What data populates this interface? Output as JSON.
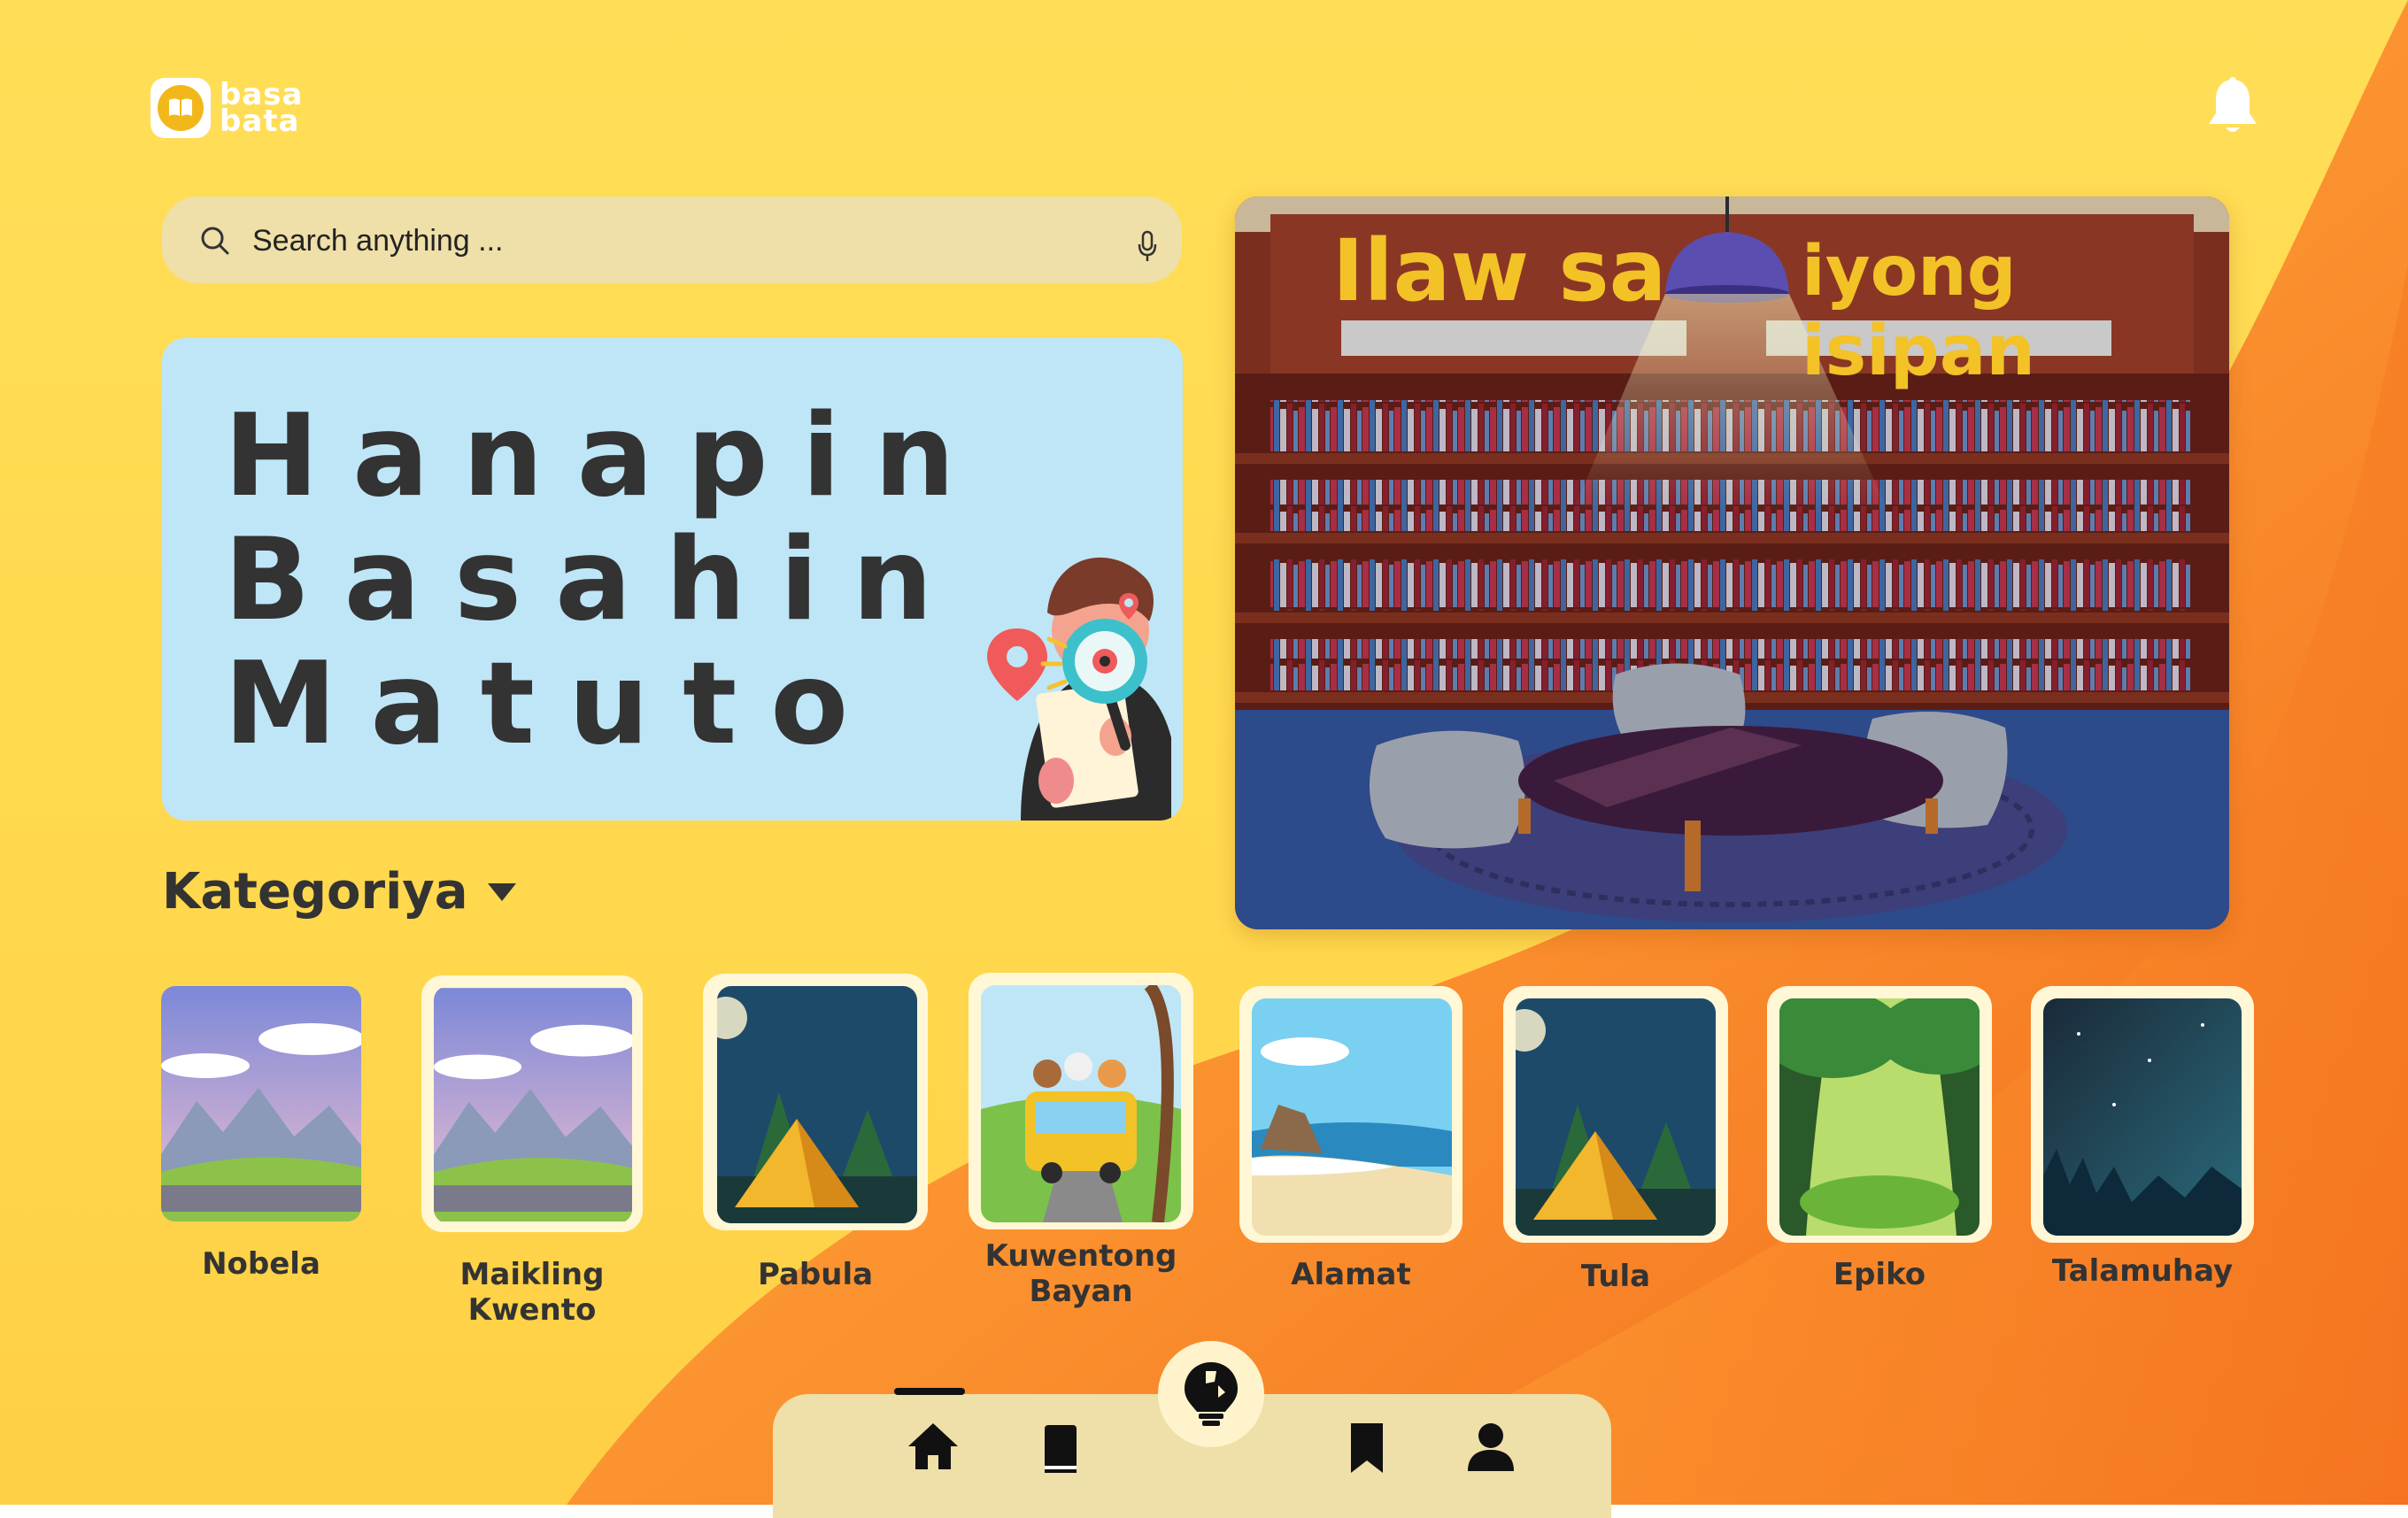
{
  "app": {
    "logo_text_top": "basa",
    "logo_text_bottom": "bata"
  },
  "search": {
    "placeholder": "Search anything ..."
  },
  "hero": {
    "line1": "Hanapin",
    "line2": "Basahin",
    "line3": "Matuto"
  },
  "banner": {
    "title_left": "Ilaw sa",
    "title_right": "iyong isipan"
  },
  "categories": {
    "title": "Kategoriya",
    "items": [
      {
        "label": "Nobela",
        "scene": "mountain"
      },
      {
        "label": "Maikling\nKwento",
        "scene": "mountain"
      },
      {
        "label": "Pabula",
        "scene": "camp"
      },
      {
        "label": "Kuwentong\nBayan",
        "scene": "bus"
      },
      {
        "label": "Alamat",
        "scene": "beach"
      },
      {
        "label": "Tula",
        "scene": "camp"
      },
      {
        "label": "Epiko",
        "scene": "forest"
      },
      {
        "label": "Talamuhay",
        "scene": "night"
      }
    ]
  },
  "nav": {
    "items": [
      "home-icon",
      "book-icon",
      "lightbulb-icon",
      "bookmark-icon",
      "user-icon"
    ],
    "active": "home-icon"
  },
  "colors": {
    "background": "#ffd84e",
    "accent_orange": "#f78a2a",
    "search_bg": "#efdfa8",
    "hero_bg": "#bfe6f7",
    "text_dark": "#333333",
    "banner_title": "#f2c227"
  }
}
